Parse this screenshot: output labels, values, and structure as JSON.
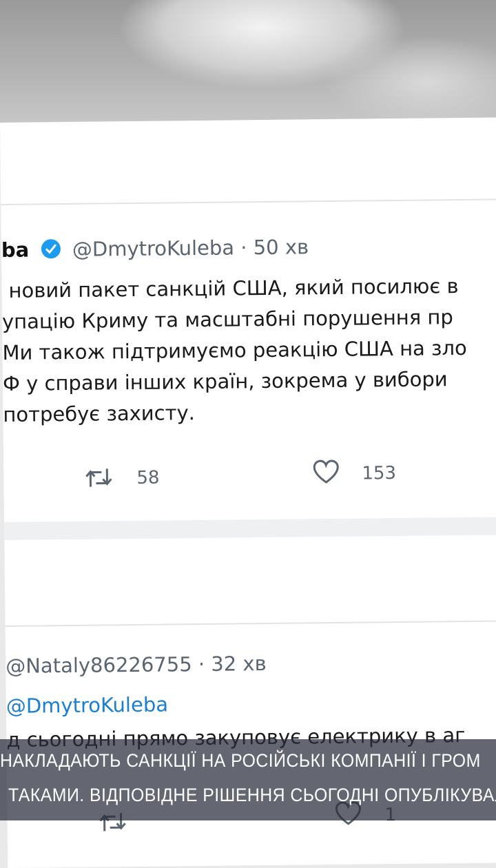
{
  "tweet1": {
    "username_fragment": "ba",
    "handle": "@DmytroKuleba · 50 хв",
    "text_lines": [
      "новий пакет санкцій США, який посилює в",
      "упацію Криму та масштабні порушення пр",
      "Ми також підтримуємо реакцію США на зло",
      "Ф у справи інших країн, зокрема у вибори",
      "потребує захисту."
    ],
    "retweets": "58",
    "likes": "153"
  },
  "tweet2": {
    "handle": "@Nataly86226755 · 32 хв",
    "reply_to": "@DmytroKuleba",
    "text_partial": "д сьогодні прямо закуповує електрику в аг",
    "likes": "1"
  },
  "caption": {
    "line1": "НАКЛАДАЮТЬ САНКЦІЇ НА РОСІЙСЬКІ КОМПАНІЇ І ГРОМ",
    "line2": "ТАКАМИ. ВІДПОВІДНЕ РІШЕННЯ СЬОГОДНІ ОПУБЛІКУВАЛ"
  },
  "colors": {
    "verified": "#1d9bf0",
    "mention": "#1b7fd1"
  }
}
